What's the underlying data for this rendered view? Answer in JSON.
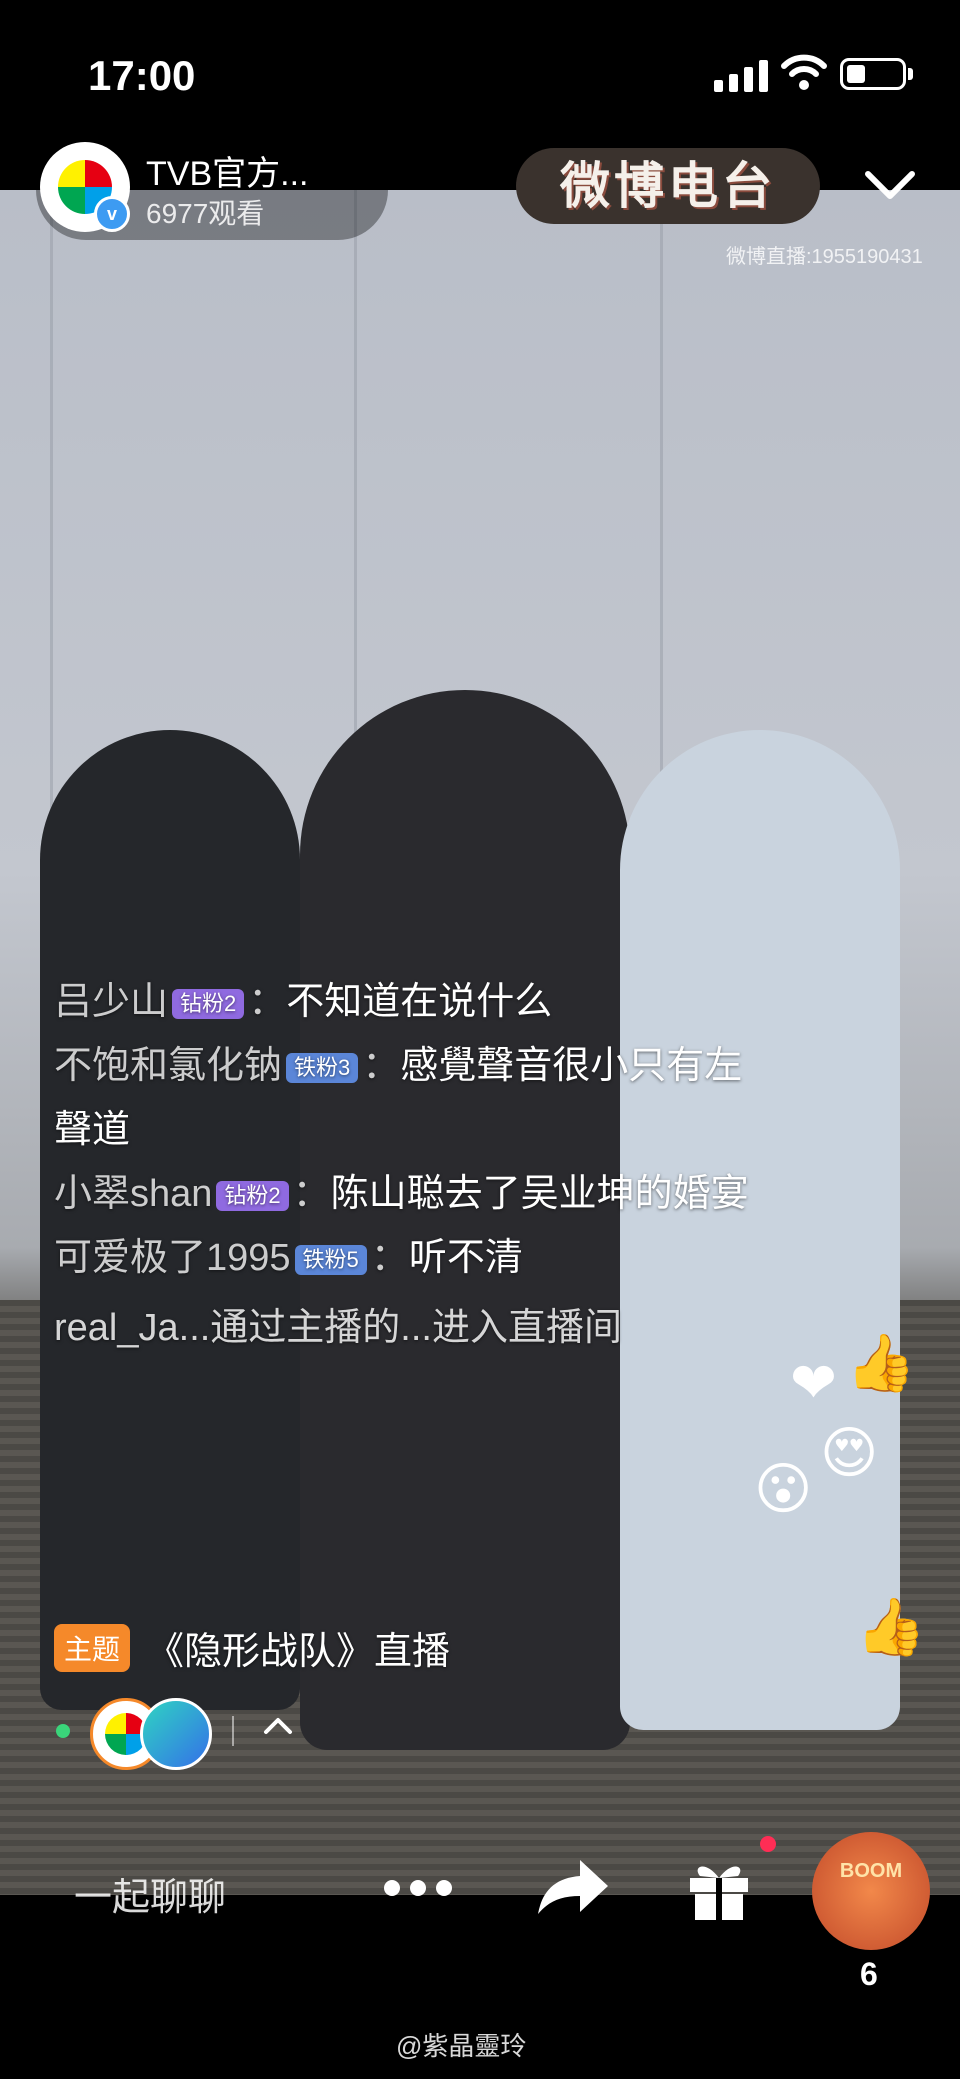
{
  "status_bar": {
    "time": "17:00"
  },
  "header": {
    "host_name": "TVB官方...",
    "viewers": "6977观看",
    "brand_logo_text": "微博电台",
    "room_id": "微博直播:1955190431"
  },
  "comments": [
    {
      "user": "吕少山",
      "badge": "钻粉2",
      "badge_type": "diamond",
      "text": "不知道在说什么"
    },
    {
      "user": "不饱和氯化钠",
      "badge": "铁粉3",
      "badge_type": "iron",
      "text": "感覺聲音很小只有左聲道"
    },
    {
      "user": "小翠shan",
      "badge": "钻粉2",
      "badge_type": "diamond",
      "text": "陈山聪去了吴业坤的婚宴"
    },
    {
      "user": "可爱极了1995",
      "badge": "铁粉5",
      "badge_type": "iron",
      "text": "听不清"
    }
  ],
  "system_message": "real_Ja...通过主播的...进入直播间",
  "topic": {
    "tag": "主题",
    "title": "《隐形战队》直播"
  },
  "bottom": {
    "chat_placeholder": "一起聊聊",
    "boom_label": "BOOM",
    "boom_count": "6"
  },
  "watermark": "@紫晶靈玲",
  "colors": {
    "topic_tag": "#f5892a",
    "diamond_badge": "#8f6ae0",
    "iron_badge": "#5b86d8",
    "online": "#3ad47a"
  },
  "icons": [
    "tvb-logo-icon",
    "verified-icon",
    "chevron-down-icon",
    "chevron-up-icon",
    "more-icon",
    "share-icon",
    "gift-icon",
    "boom-gift-icon"
  ]
}
